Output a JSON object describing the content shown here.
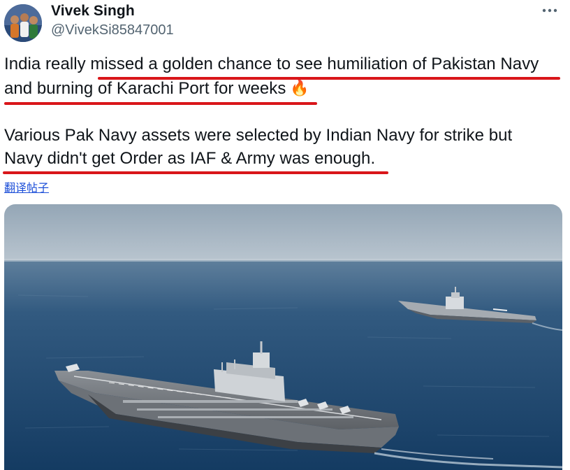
{
  "author": {
    "name": "Vivek Singh",
    "handle": "@VivekSi85847001"
  },
  "tweet": {
    "line1": "India really missed a golden chance to see humiliation of Pakistan Navy",
    "line2": "and burning of Karachi Port for weeks",
    "line2_emoji": "🔥",
    "line3": "Various Pak Navy assets were selected by Indian Navy for strike but",
    "line4": "Navy didn't get Order as IAF & Army was enough."
  },
  "translate_link": "翻译帖子",
  "more_menu": "•••",
  "media": {
    "subject": "two aircraft carriers at sea"
  },
  "colors": {
    "underline": "#d9161a",
    "link": "#1d4fd8",
    "text": "#0f1419",
    "secondary": "#536471"
  },
  "icons": [
    "more-icon",
    "fire-emoji-icon"
  ]
}
